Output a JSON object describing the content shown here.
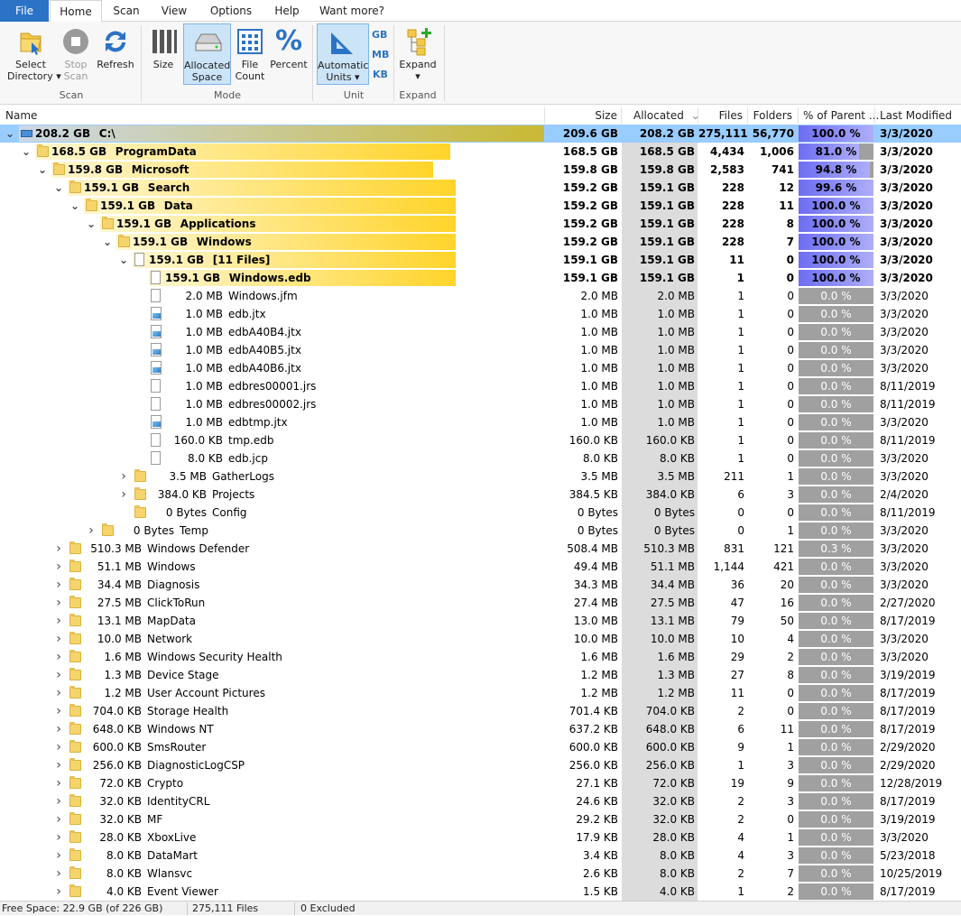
{
  "tabs": [
    "File",
    "Home",
    "Scan",
    "View",
    "Options",
    "Help",
    "Want more?"
  ],
  "ribbon": {
    "select_directory": "Select\nDirectory ▾",
    "stop_scan": "Stop\nScan",
    "refresh": "Refresh",
    "size": "Size",
    "allocated_space": "Allocated\nSpace",
    "file_count": "File\nCount",
    "percent": "Percent",
    "automatic_units": "Automatic\nUnits ▾",
    "unit_gb": "GB",
    "unit_mb": "MB",
    "unit_kb": "KB",
    "expand": "Expand\n▾",
    "groups": {
      "scan": "Scan",
      "mode": "Mode",
      "unit": "Unit",
      "expand": "Expand"
    }
  },
  "columns": {
    "name": "Name",
    "size": "Size",
    "allocated": "Allocated",
    "allocated_sort": "⌄",
    "files": "Files",
    "folders": "Folders",
    "percent": "% of Parent ...",
    "modified": "Last Modified"
  },
  "colors": {
    "accent": "#2b73c6",
    "selection": "#99ccff",
    "bar_gold": "#ffd42a",
    "bar_olive": "#c9b934",
    "percent_bar": "#6d6df2"
  },
  "rows": [
    {
      "level": 0,
      "exp": "v",
      "icon": "drive-icon",
      "label": "208.2 GB",
      "name": "C:\\",
      "size": "209.6 GB",
      "alloc": "208.2 GB",
      "files": "275,111",
      "folders": "56,770",
      "pct": "100.0 %",
      "pv": 1.0,
      "mod": "3/3/2020",
      "bold": true,
      "sel": true,
      "bar": 1.0
    },
    {
      "level": 1,
      "exp": "v",
      "icon": "folder",
      "label": "168.5 GB",
      "name": "ProgramData",
      "size": "168.5 GB",
      "alloc": "168.5 GB",
      "files": "4,434",
      "folders": "1,006",
      "pct": "81.0 %",
      "pv": 0.81,
      "mod": "3/3/2020",
      "bold": true,
      "bar": 0.81
    },
    {
      "level": 2,
      "exp": "v",
      "icon": "folder",
      "label": "159.8 GB",
      "name": "Microsoft",
      "size": "159.8 GB",
      "alloc": "159.8 GB",
      "files": "2,583",
      "folders": "741",
      "pct": "94.8 %",
      "pv": 0.948,
      "mod": "3/3/2020",
      "bold": true,
      "bar": 0.948
    },
    {
      "level": 3,
      "exp": "v",
      "icon": "folder",
      "label": "159.1 GB",
      "name": "Search",
      "size": "159.2 GB",
      "alloc": "159.1 GB",
      "files": "228",
      "folders": "12",
      "pct": "99.6 %",
      "pv": 0.996,
      "mod": "3/3/2020",
      "bold": true,
      "bar": 0.996
    },
    {
      "level": 4,
      "exp": "v",
      "icon": "folder",
      "label": "159.1 GB",
      "name": "Data",
      "size": "159.2 GB",
      "alloc": "159.1 GB",
      "files": "228",
      "folders": "11",
      "pct": "100.0 %",
      "pv": 1.0,
      "mod": "3/3/2020",
      "bold": true,
      "bar": 1.0
    },
    {
      "level": 5,
      "exp": "v",
      "icon": "folder",
      "label": "159.1 GB",
      "name": "Applications",
      "size": "159.2 GB",
      "alloc": "159.1 GB",
      "files": "228",
      "folders": "8",
      "pct": "100.0 %",
      "pv": 1.0,
      "mod": "3/3/2020",
      "bold": true,
      "bar": 1.0
    },
    {
      "level": 6,
      "exp": "v",
      "icon": "folder",
      "label": "159.1 GB",
      "name": "Windows",
      "size": "159.2 GB",
      "alloc": "159.1 GB",
      "files": "228",
      "folders": "7",
      "pct": "100.0 %",
      "pv": 1.0,
      "mod": "3/3/2020",
      "bold": true,
      "bar": 1.0
    },
    {
      "level": 7,
      "exp": "v",
      "icon": "doc",
      "label": "159.1 GB",
      "name": "[11 Files]",
      "size": "159.1 GB",
      "alloc": "159.1 GB",
      "files": "11",
      "folders": "0",
      "pct": "100.0 %",
      "pv": 1.0,
      "mod": "3/3/2020",
      "bold": true,
      "bar": 1.0
    },
    {
      "level": 8,
      "exp": "",
      "icon": "doc",
      "label": "159.1 GB",
      "name": "Windows.edb",
      "size": "159.1 GB",
      "alloc": "159.1 GB",
      "files": "1",
      "folders": "0",
      "pct": "100.0 %",
      "pv": 1.0,
      "mod": "3/3/2020",
      "bold": true,
      "bar": 1.0
    },
    {
      "level": 8,
      "exp": "",
      "icon": "doc",
      "label": "2.0 MB",
      "name": "Windows.jfm",
      "size": "2.0 MB",
      "alloc": "2.0 MB",
      "files": "1",
      "folders": "0",
      "pct": "0.0 %",
      "pv": 0,
      "mod": "3/3/2020"
    },
    {
      "level": 8,
      "exp": "",
      "icon": "jtx",
      "label": "1.0 MB",
      "name": "edb.jtx",
      "size": "1.0 MB",
      "alloc": "1.0 MB",
      "files": "1",
      "folders": "0",
      "pct": "0.0 %",
      "pv": 0,
      "mod": "3/3/2020"
    },
    {
      "level": 8,
      "exp": "",
      "icon": "jtx",
      "label": "1.0 MB",
      "name": "edbA40B4.jtx",
      "size": "1.0 MB",
      "alloc": "1.0 MB",
      "files": "1",
      "folders": "0",
      "pct": "0.0 %",
      "pv": 0,
      "mod": "3/3/2020"
    },
    {
      "level": 8,
      "exp": "",
      "icon": "jtx",
      "label": "1.0 MB",
      "name": "edbA40B5.jtx",
      "size": "1.0 MB",
      "alloc": "1.0 MB",
      "files": "1",
      "folders": "0",
      "pct": "0.0 %",
      "pv": 0,
      "mod": "3/3/2020"
    },
    {
      "level": 8,
      "exp": "",
      "icon": "jtx",
      "label": "1.0 MB",
      "name": "edbA40B6.jtx",
      "size": "1.0 MB",
      "alloc": "1.0 MB",
      "files": "1",
      "folders": "0",
      "pct": "0.0 %",
      "pv": 0,
      "mod": "3/3/2020"
    },
    {
      "level": 8,
      "exp": "",
      "icon": "doc",
      "label": "1.0 MB",
      "name": "edbres00001.jrs",
      "size": "1.0 MB",
      "alloc": "1.0 MB",
      "files": "1",
      "folders": "0",
      "pct": "0.0 %",
      "pv": 0,
      "mod": "8/11/2019"
    },
    {
      "level": 8,
      "exp": "",
      "icon": "doc",
      "label": "1.0 MB",
      "name": "edbres00002.jrs",
      "size": "1.0 MB",
      "alloc": "1.0 MB",
      "files": "1",
      "folders": "0",
      "pct": "0.0 %",
      "pv": 0,
      "mod": "8/11/2019"
    },
    {
      "level": 8,
      "exp": "",
      "icon": "jtx",
      "label": "1.0 MB",
      "name": "edbtmp.jtx",
      "size": "1.0 MB",
      "alloc": "1.0 MB",
      "files": "1",
      "folders": "0",
      "pct": "0.0 %",
      "pv": 0,
      "mod": "3/3/2020"
    },
    {
      "level": 8,
      "exp": "",
      "icon": "doc",
      "label": "160.0 KB",
      "name": "tmp.edb",
      "size": "160.0 KB",
      "alloc": "160.0 KB",
      "files": "1",
      "folders": "0",
      "pct": "0.0 %",
      "pv": 0,
      "mod": "8/11/2019"
    },
    {
      "level": 8,
      "exp": "",
      "icon": "doc",
      "label": "8.0 KB",
      "name": "edb.jcp",
      "size": "8.0 KB",
      "alloc": "8.0 KB",
      "files": "1",
      "folders": "0",
      "pct": "0.0 %",
      "pv": 0,
      "mod": "3/3/2020"
    },
    {
      "level": 7,
      "exp": ">",
      "icon": "folder",
      "label": "3.5 MB",
      "name": "GatherLogs",
      "size": "3.5 MB",
      "alloc": "3.5 MB",
      "files": "211",
      "folders": "1",
      "pct": "0.0 %",
      "pv": 0,
      "mod": "3/3/2020"
    },
    {
      "level": 7,
      "exp": ">",
      "icon": "folder",
      "label": "384.0 KB",
      "name": "Projects",
      "size": "384.5 KB",
      "alloc": "384.0 KB",
      "files": "6",
      "folders": "3",
      "pct": "0.0 %",
      "pv": 0,
      "mod": "2/4/2020"
    },
    {
      "level": 7,
      "exp": "",
      "icon": "folder",
      "label": "0 Bytes",
      "name": "Config",
      "size": "0 Bytes",
      "alloc": "0 Bytes",
      "files": "0",
      "folders": "0",
      "pct": "0.0 %",
      "pv": 0,
      "mod": "8/11/2019"
    },
    {
      "level": 5,
      "exp": ">",
      "icon": "folder",
      "label": "0 Bytes",
      "name": "Temp",
      "size": "0 Bytes",
      "alloc": "0 Bytes",
      "files": "0",
      "folders": "1",
      "pct": "0.0 %",
      "pv": 0,
      "mod": "3/3/2020"
    },
    {
      "level": 3,
      "exp": ">",
      "icon": "folder",
      "label": "510.3 MB",
      "name": "Windows Defender",
      "size": "508.4 MB",
      "alloc": "510.3 MB",
      "files": "831",
      "folders": "121",
      "pct": "0.3 %",
      "pv": 0.003,
      "mod": "3/3/2020"
    },
    {
      "level": 3,
      "exp": ">",
      "icon": "folder",
      "label": "51.1 MB",
      "name": "Windows",
      "size": "49.4 MB",
      "alloc": "51.1 MB",
      "files": "1,144",
      "folders": "421",
      "pct": "0.0 %",
      "pv": 0,
      "mod": "3/3/2020"
    },
    {
      "level": 3,
      "exp": ">",
      "icon": "folder",
      "label": "34.4 MB",
      "name": "Diagnosis",
      "size": "34.3 MB",
      "alloc": "34.4 MB",
      "files": "36",
      "folders": "20",
      "pct": "0.0 %",
      "pv": 0,
      "mod": "3/3/2020"
    },
    {
      "level": 3,
      "exp": ">",
      "icon": "folder",
      "label": "27.5 MB",
      "name": "ClickToRun",
      "size": "27.4 MB",
      "alloc": "27.5 MB",
      "files": "47",
      "folders": "16",
      "pct": "0.0 %",
      "pv": 0,
      "mod": "2/27/2020"
    },
    {
      "level": 3,
      "exp": ">",
      "icon": "folder",
      "label": "13.1 MB",
      "name": "MapData",
      "size": "13.0 MB",
      "alloc": "13.1 MB",
      "files": "79",
      "folders": "50",
      "pct": "0.0 %",
      "pv": 0,
      "mod": "8/17/2019"
    },
    {
      "level": 3,
      "exp": ">",
      "icon": "folder",
      "label": "10.0 MB",
      "name": "Network",
      "size": "10.0 MB",
      "alloc": "10.0 MB",
      "files": "10",
      "folders": "4",
      "pct": "0.0 %",
      "pv": 0,
      "mod": "3/3/2020"
    },
    {
      "level": 3,
      "exp": ">",
      "icon": "folder",
      "label": "1.6 MB",
      "name": "Windows Security Health",
      "size": "1.6 MB",
      "alloc": "1.6 MB",
      "files": "29",
      "folders": "2",
      "pct": "0.0 %",
      "pv": 0,
      "mod": "3/3/2020"
    },
    {
      "level": 3,
      "exp": ">",
      "icon": "folder",
      "label": "1.3 MB",
      "name": "Device Stage",
      "size": "1.2 MB",
      "alloc": "1.3 MB",
      "files": "27",
      "folders": "8",
      "pct": "0.0 %",
      "pv": 0,
      "mod": "3/19/2019"
    },
    {
      "level": 3,
      "exp": ">",
      "icon": "folder",
      "label": "1.2 MB",
      "name": "User Account Pictures",
      "size": "1.2 MB",
      "alloc": "1.2 MB",
      "files": "11",
      "folders": "0",
      "pct": "0.0 %",
      "pv": 0,
      "mod": "8/17/2019"
    },
    {
      "level": 3,
      "exp": ">",
      "icon": "folder",
      "label": "704.0 KB",
      "name": "Storage Health",
      "size": "701.4 KB",
      "alloc": "704.0 KB",
      "files": "2",
      "folders": "0",
      "pct": "0.0 %",
      "pv": 0,
      "mod": "8/17/2019"
    },
    {
      "level": 3,
      "exp": ">",
      "icon": "folder",
      "label": "648.0 KB",
      "name": "Windows NT",
      "size": "637.2 KB",
      "alloc": "648.0 KB",
      "files": "6",
      "folders": "11",
      "pct": "0.0 %",
      "pv": 0,
      "mod": "8/17/2019"
    },
    {
      "level": 3,
      "exp": ">",
      "icon": "folder",
      "label": "600.0 KB",
      "name": "SmsRouter",
      "size": "600.0 KB",
      "alloc": "600.0 KB",
      "files": "9",
      "folders": "1",
      "pct": "0.0 %",
      "pv": 0,
      "mod": "2/29/2020"
    },
    {
      "level": 3,
      "exp": ">",
      "icon": "folder",
      "label": "256.0 KB",
      "name": "DiagnosticLogCSP",
      "size": "256.0 KB",
      "alloc": "256.0 KB",
      "files": "1",
      "folders": "3",
      "pct": "0.0 %",
      "pv": 0,
      "mod": "2/29/2020"
    },
    {
      "level": 3,
      "exp": ">",
      "icon": "folder",
      "label": "72.0 KB",
      "name": "Crypto",
      "size": "27.1 KB",
      "alloc": "72.0 KB",
      "files": "19",
      "folders": "9",
      "pct": "0.0 %",
      "pv": 0,
      "mod": "12/28/2019"
    },
    {
      "level": 3,
      "exp": ">",
      "icon": "folder",
      "label": "32.0 KB",
      "name": "IdentityCRL",
      "size": "24.6 KB",
      "alloc": "32.0 KB",
      "files": "2",
      "folders": "3",
      "pct": "0.0 %",
      "pv": 0,
      "mod": "8/17/2019"
    },
    {
      "level": 3,
      "exp": ">",
      "icon": "folder",
      "label": "32.0 KB",
      "name": "MF",
      "size": "29.2 KB",
      "alloc": "32.0 KB",
      "files": "2",
      "folders": "0",
      "pct": "0.0 %",
      "pv": 0,
      "mod": "3/19/2019"
    },
    {
      "level": 3,
      "exp": ">",
      "icon": "folder",
      "label": "28.0 KB",
      "name": "XboxLive",
      "size": "17.9 KB",
      "alloc": "28.0 KB",
      "files": "4",
      "folders": "1",
      "pct": "0.0 %",
      "pv": 0,
      "mod": "3/3/2020"
    },
    {
      "level": 3,
      "exp": ">",
      "icon": "folder",
      "label": "8.0 KB",
      "name": "DataMart",
      "size": "3.4 KB",
      "alloc": "8.0 KB",
      "files": "4",
      "folders": "3",
      "pct": "0.0 %",
      "pv": 0,
      "mod": "5/23/2018"
    },
    {
      "level": 3,
      "exp": ">",
      "icon": "folder",
      "label": "8.0 KB",
      "name": "Wlansvc",
      "size": "2.6 KB",
      "alloc": "8.0 KB",
      "files": "2",
      "folders": "7",
      "pct": "0.0 %",
      "pv": 0,
      "mod": "10/25/2019"
    },
    {
      "level": 3,
      "exp": ">",
      "icon": "folder",
      "label": "4.0 KB",
      "name": "Event Viewer",
      "size": "1.5 KB",
      "alloc": "4.0 KB",
      "files": "1",
      "folders": "2",
      "pct": "0.0 %",
      "pv": 0,
      "mod": "8/17/2019"
    }
  ],
  "status": {
    "free_space": "Free Space: 22.9 GB  (of 226 GB)",
    "files": "275,111 Files",
    "excluded": "0 Excluded"
  }
}
